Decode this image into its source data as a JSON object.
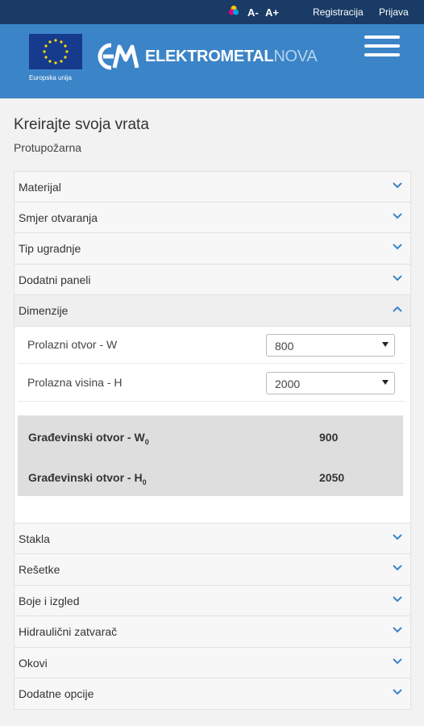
{
  "topbar": {
    "font_decrease": "A-",
    "font_increase": "A+",
    "register": "Registracija",
    "login": "Prijava"
  },
  "header": {
    "eu_label": "Europska unija",
    "brand_name": "ELEKTROMETAL",
    "brand_suffix": "NOVA",
    "colors": {
      "topbar": "#1a3b66",
      "header": "#3b84c8"
    }
  },
  "page": {
    "title": "Kreirajte svoja vrata",
    "subtitle": "Protupožarna"
  },
  "accordion_top": [
    {
      "label": "Materijal",
      "state": "collapsed"
    },
    {
      "label": "Smjer otvaranja",
      "state": "collapsed"
    },
    {
      "label": "Tip ugradnje",
      "state": "collapsed"
    },
    {
      "label": "Dodatni paneli",
      "state": "collapsed"
    },
    {
      "label": "Dimenzije",
      "state": "expanded"
    }
  ],
  "dimenzije": {
    "fields": [
      {
        "label": "Prolazni otvor - W",
        "value": "800"
      },
      {
        "label": "Prolazna visina - H",
        "value": "2000"
      }
    ],
    "calc": [
      {
        "label": "Građevinski otvor - W",
        "sub": "0",
        "value": "900"
      },
      {
        "label": "Građevinski otvor - H",
        "sub": "0",
        "value": "2050"
      }
    ]
  },
  "accordion_bottom": [
    {
      "label": "Stakla",
      "state": "collapsed"
    },
    {
      "label": "Rešetke",
      "state": "collapsed"
    },
    {
      "label": "Boje i izgled",
      "state": "collapsed"
    },
    {
      "label": "Hidraulični zatvarač",
      "state": "collapsed"
    },
    {
      "label": "Okovi",
      "state": "collapsed"
    },
    {
      "label": "Dodatne opcije",
      "state": "collapsed"
    }
  ],
  "icons": {
    "accessibility_color": "color-palette-icon",
    "menu": "hamburger-menu-icon",
    "collapsed": "chevron-down-icon",
    "expanded": "chevron-up-icon"
  }
}
